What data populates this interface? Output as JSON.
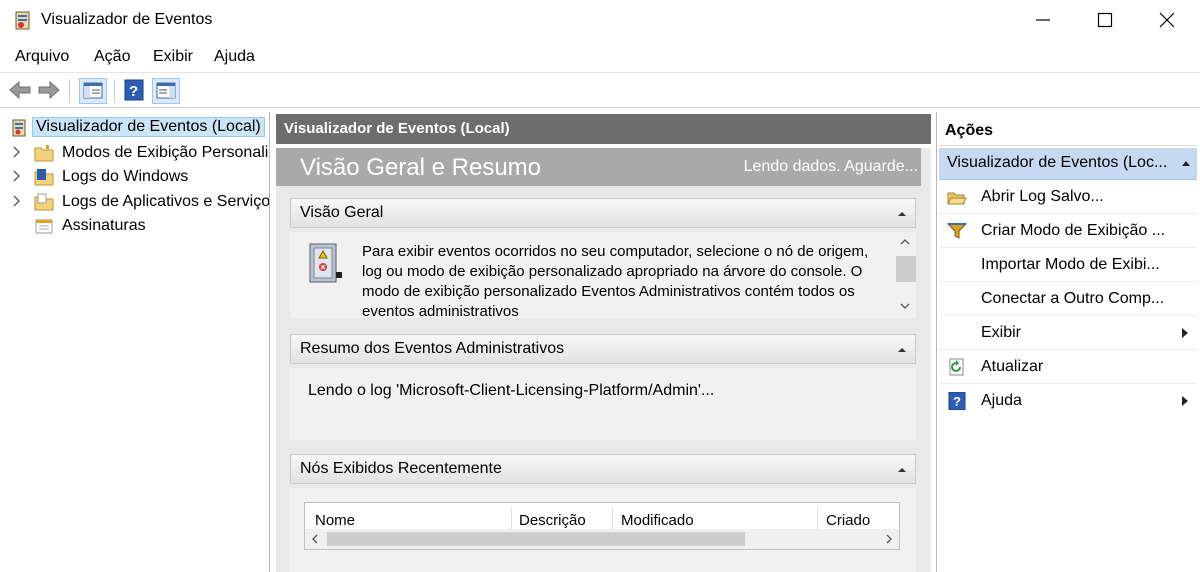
{
  "window": {
    "title": "Visualizador de Eventos"
  },
  "menu": [
    "Arquivo",
    "Ação",
    "Exibir",
    "Ajuda"
  ],
  "tree": {
    "root": "Visualizador de Eventos (Local)",
    "items": [
      "Modos de Exibição Personali",
      "Logs do Windows",
      "Logs de Aplicativos e Serviço",
      "Assinaturas"
    ]
  },
  "center": {
    "header": "Visualizador de Eventos (Local)",
    "banner_title": "Visão Geral e Resumo",
    "banner_status": "Lendo dados. Aguarde...",
    "overview": {
      "title": "Visão Geral",
      "text": "Para exibir eventos ocorridos no seu computador, selecione o nó de origem, log ou modo de exibição personalizado apropriado na árvore do console. O modo de exibição personalizado Eventos Administrativos contém todos os eventos administrativos"
    },
    "summary": {
      "title": "Resumo dos Eventos Administrativos",
      "text": "Lendo o log 'Microsoft-Client-Licensing-Platform/Admin'..."
    },
    "recent": {
      "title": "Nós Exibidos Recentemente",
      "columns": [
        "Nome",
        "Descrição",
        "Modificado",
        "Criado"
      ]
    }
  },
  "actions": {
    "title": "Ações",
    "group": "Visualizador de Eventos (Loc...",
    "items": [
      {
        "label": "Abrir Log Salvo...",
        "icon": "folder-open-icon"
      },
      {
        "label": "Criar Modo de Exibição ...",
        "icon": "filter-icon"
      },
      {
        "label": "Importar Modo de Exibi...",
        "icon": ""
      },
      {
        "label": "Conectar a Outro Comp...",
        "icon": ""
      },
      {
        "label": "Exibir",
        "icon": ""
      },
      {
        "label": "Atualizar",
        "icon": "refresh-icon"
      },
      {
        "label": "Ajuda",
        "icon": "help-icon"
      }
    ]
  },
  "colors": {
    "selection": "#cce4f7",
    "actions_group": "#c5d9f1",
    "center_header": "#6d6d6d"
  }
}
